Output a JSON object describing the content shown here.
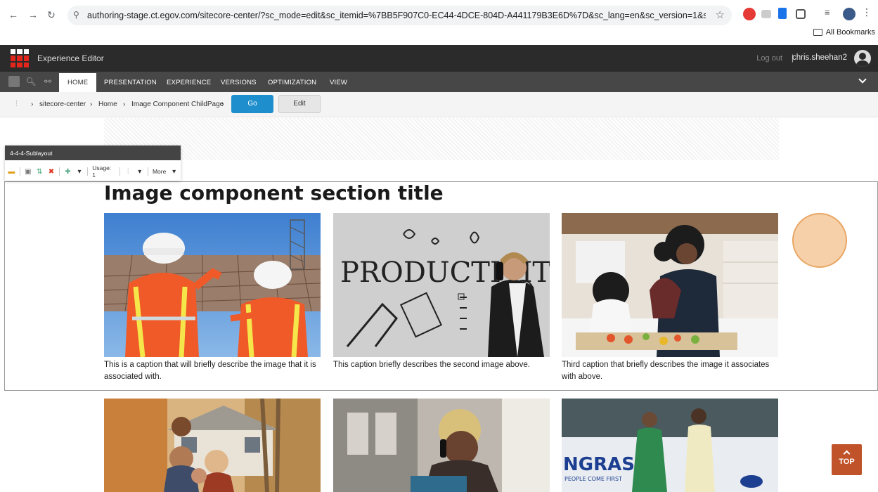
{
  "browser": {
    "url": "authoring-stage.ct.egov.com/sitecore-center/?sc_mode=edit&sc_itemid=%7BB5F907C0-EC44-4DCE-804D-A441179B3E6D%7D&sc_lang=en&sc_version=1&sc_site=sitecore-ce...",
    "bookmarks_label": "All Bookmarks"
  },
  "header": {
    "app_title": "Experience Editor",
    "logout": "Log out",
    "separator": "|",
    "username": "chris.sheehan2"
  },
  "ribbon": {
    "tabs": [
      "HOME",
      "PRESENTATION",
      "EXPERIENCE",
      "VERSIONS",
      "OPTIMIZATION",
      "VIEW"
    ]
  },
  "breadcrumb": {
    "items": [
      "sitecore-center",
      "Home",
      "Image Component ChildPage"
    ],
    "go_label": "Go",
    "edit_label": "Edit"
  },
  "component_chrome": {
    "title": "4-4-4-Sublayout",
    "usage": "Usage: 1",
    "more": "More"
  },
  "content": {
    "section_title": "Image component section title",
    "captions": [
      "This is a caption that will briefly describe the image that it is associated with.",
      "This caption briefly describes the second image above.",
      "Third caption that briefly describes the image it associates with above."
    ],
    "image2_text": "PRODUCTIVITY",
    "image6_text": "NGRAS",
    "image6_subtext": "PEOPLE COME FIRST"
  },
  "top_button": "TOP"
}
